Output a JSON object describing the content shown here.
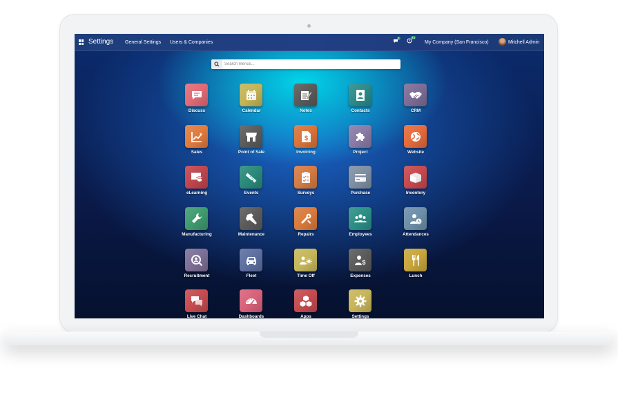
{
  "navbar": {
    "title": "Settings",
    "menu": [
      "General Settings",
      "Users & Companies"
    ],
    "chat_count": "3",
    "activity_count": "44",
    "company": "My Company (San Francisco)",
    "user": "Mitchell Admin"
  },
  "search": {
    "placeholder": "Search menus..."
  },
  "apps": [
    {
      "label": "Discuss",
      "icon": "chat-bubble-icon",
      "color": "#e06a75"
    },
    {
      "label": "Calendar",
      "icon": "calendar-icon",
      "color": "#c4b457"
    },
    {
      "label": "Notes",
      "icon": "note-pencil-icon",
      "color": "#5a5a5a"
    },
    {
      "label": "Contacts",
      "icon": "address-book-icon",
      "color": "#2b8a8a"
    },
    {
      "label": "CRM",
      "icon": "handshake-icon",
      "color": "#7d6c96"
    },
    {
      "label": "Sales",
      "icon": "trend-chart-icon",
      "color": "#e07b3f"
    },
    {
      "label": "Point of Sale",
      "icon": "shop-icon",
      "color": "#5b5b5b"
    },
    {
      "label": "Invoicing",
      "icon": "invoice-dollar-icon",
      "color": "#d9733a"
    },
    {
      "label": "Project",
      "icon": "puzzle-icon",
      "color": "#8a7aa6"
    },
    {
      "label": "Website",
      "icon": "globe-icon",
      "color": "#e56a3b"
    },
    {
      "label": "eLearning",
      "icon": "graduation-screen-icon",
      "color": "#c0454d"
    },
    {
      "label": "Events",
      "icon": "ticket-icon",
      "color": "#2a8a7a"
    },
    {
      "label": "Surveys",
      "icon": "clipboard-check-icon",
      "color": "#d47b45"
    },
    {
      "label": "Purchase",
      "icon": "credit-card-icon",
      "color": "#7f8fa3"
    },
    {
      "label": "Inventory",
      "icon": "box-icon",
      "color": "#c5494e"
    },
    {
      "label": "Manufacturing",
      "icon": "wrench-icon",
      "color": "#3f9a6f"
    },
    {
      "label": "Maintenance",
      "icon": "hammer-icon",
      "color": "#5b5b5b"
    },
    {
      "label": "Repairs",
      "icon": "tools-icon",
      "color": "#d97a3c"
    },
    {
      "label": "Employees",
      "icon": "people-icon",
      "color": "#2b8f86"
    },
    {
      "label": "Attendances",
      "icon": "user-clock-icon",
      "color": "#6d8fa8"
    },
    {
      "label": "Recruitment",
      "icon": "magnifier-person-icon",
      "color": "#7d6f96"
    },
    {
      "label": "Fleet",
      "icon": "car-icon",
      "color": "#5e6fa0"
    },
    {
      "label": "Time Off",
      "icon": "people-sun-icon",
      "color": "#c7b75b"
    },
    {
      "label": "Expenses",
      "icon": "user-dollar-icon",
      "color": "#5b5b5b"
    },
    {
      "label": "Lunch",
      "icon": "fork-knife-icon",
      "color": "#c8a63d"
    },
    {
      "label": "Live Chat",
      "icon": "speech-bubbles-icon",
      "color": "#c64b4f"
    },
    {
      "label": "Dashboards",
      "icon": "speedometer-icon",
      "color": "#d8627a"
    },
    {
      "label": "Apps",
      "icon": "cubes-icon",
      "color": "#c44b50"
    },
    {
      "label": "Settings",
      "icon": "gear-icon",
      "color": "#c8b55a"
    }
  ]
}
